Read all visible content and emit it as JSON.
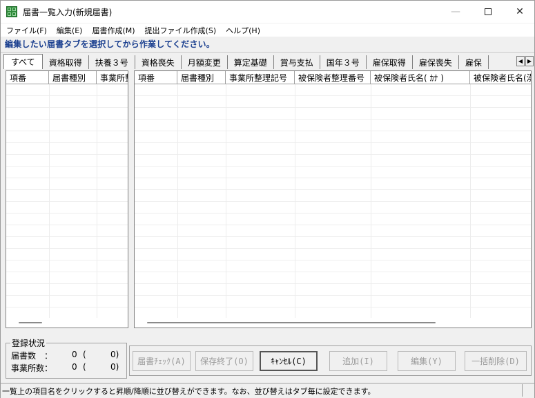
{
  "window": {
    "title": "届書一覧入力(新規届書)",
    "minimize": "—",
    "close": "✕"
  },
  "menu": [
    "ファイル(F)",
    "編集(E)",
    "届書作成(M)",
    "提出ファイル作成(S)",
    "ヘルプ(H)"
  ],
  "instruction": "編集したい届書タブを選択してから作業してください。",
  "tabs": [
    "すべて",
    "資格取得",
    "扶養３号",
    "資格喪失",
    "月額変更",
    "算定基礎",
    "賞与支払",
    "国年３号",
    "雇保取得",
    "雇保喪失",
    "雇保"
  ],
  "tab_scroll": {
    "left": "◀",
    "right": "▶"
  },
  "left_grid": {
    "columns": [
      "項番",
      "届書種別",
      "事業所整"
    ]
  },
  "right_grid": {
    "columns": [
      "項番",
      "届書種別",
      "事業所整理記号",
      "被保険者整理番号",
      "被保険者氏名( ｶﾅ )",
      "被保険者氏名(漢"
    ]
  },
  "status_group": {
    "title": "登録状況",
    "count_label": "届書数　：",
    "count_value": "0",
    "count_paren_open": "(",
    "count_sub": "0)",
    "office_label": "事業所数：",
    "office_value": "0",
    "office_paren_open": "(",
    "office_sub": "0)"
  },
  "buttons": {
    "check": "届書ﾁｪｯｸ(A)",
    "save_exit": "保存終了(O)",
    "cancel": "ｷｬﾝｾﾙ(C)",
    "add": "追加(I)",
    "edit": "編集(Y)",
    "bulk_delete": "一括削除(D)"
  },
  "statusbar": "一覧上の項目名をクリックすると昇順/降順に並び替えができます。なお、並び替えはタブ毎に設定できます。"
}
